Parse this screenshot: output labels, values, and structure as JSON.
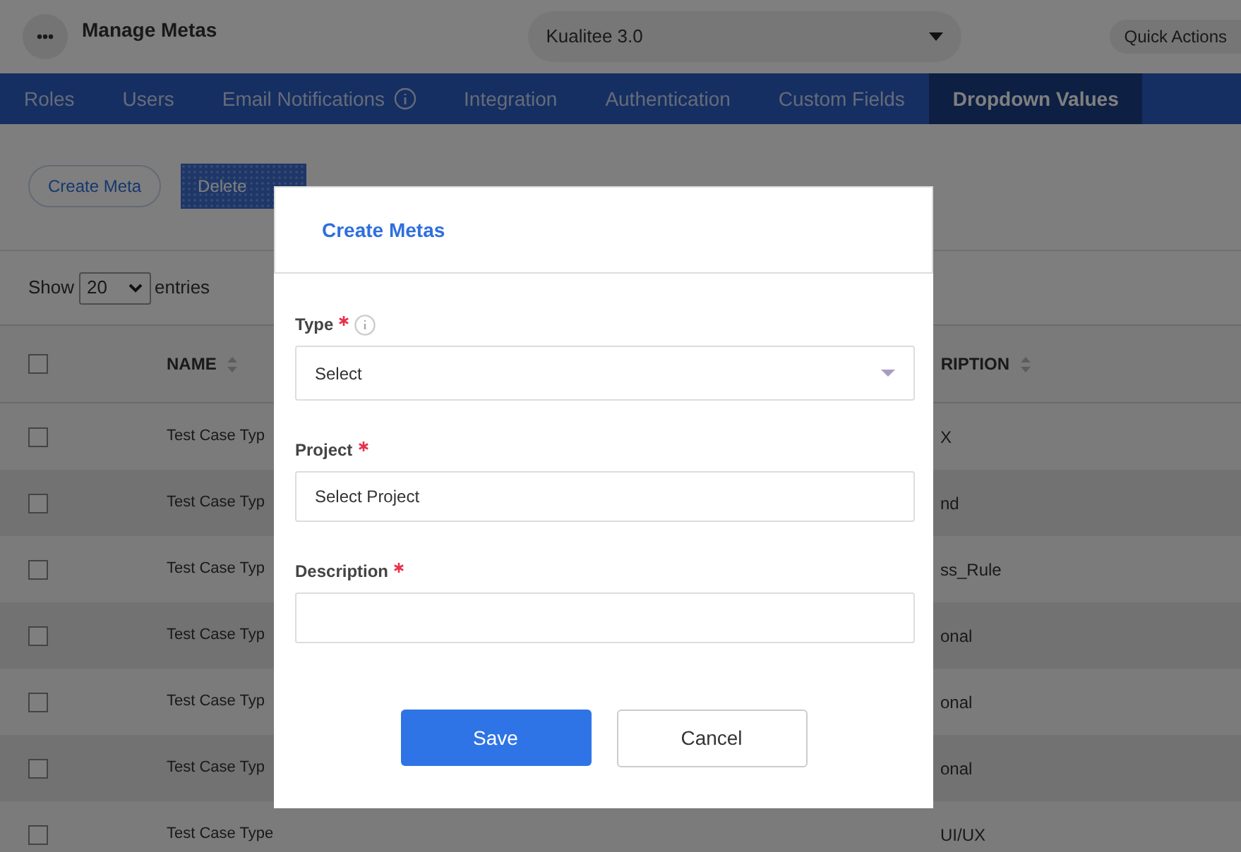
{
  "header": {
    "title": "Manage Metas",
    "project": "Kualitee 3.0",
    "quick_actions": "Quick Actions"
  },
  "tabs": [
    {
      "label": "Roles",
      "selected": false
    },
    {
      "label": "Users",
      "selected": false
    },
    {
      "label": "Email Notifications",
      "selected": false,
      "info": true
    },
    {
      "label": "Integration",
      "selected": false
    },
    {
      "label": "Authentication",
      "selected": false
    },
    {
      "label": "Custom Fields",
      "selected": false
    },
    {
      "label": "Dropdown Values",
      "selected": true
    }
  ],
  "toolbar": {
    "create": "Create Meta",
    "delete": "Delete"
  },
  "entries": {
    "show": "Show",
    "value": "20",
    "suffix": "entries"
  },
  "table": {
    "header_checked": false,
    "columns": [
      "NAME",
      "RIPTION"
    ],
    "rows": [
      {
        "checked": false,
        "name": "Test Case Typ",
        "description": "X"
      },
      {
        "checked": false,
        "name": "Test Case Typ",
        "description": "nd"
      },
      {
        "checked": false,
        "name": "Test Case Typ",
        "description": "ss_Rule"
      },
      {
        "checked": false,
        "name": "Test Case Typ",
        "description": "onal"
      },
      {
        "checked": false,
        "name": "Test Case Typ",
        "description": "onal"
      },
      {
        "checked": false,
        "name": "Test Case Typ",
        "description": "onal"
      },
      {
        "checked": false,
        "name": "Test Case Type",
        "description": "UI/UX"
      }
    ]
  },
  "modal": {
    "title": "Create Metas",
    "fields": [
      {
        "kind": "select",
        "label": "Type",
        "required": true,
        "info": true,
        "placeholder": "Select"
      },
      {
        "kind": "input",
        "label": "Project",
        "required": true,
        "placeholder": "Select Project"
      },
      {
        "kind": "input",
        "label": "Description",
        "required": true
      }
    ],
    "save": "Save",
    "cancel": "Cancel"
  }
}
